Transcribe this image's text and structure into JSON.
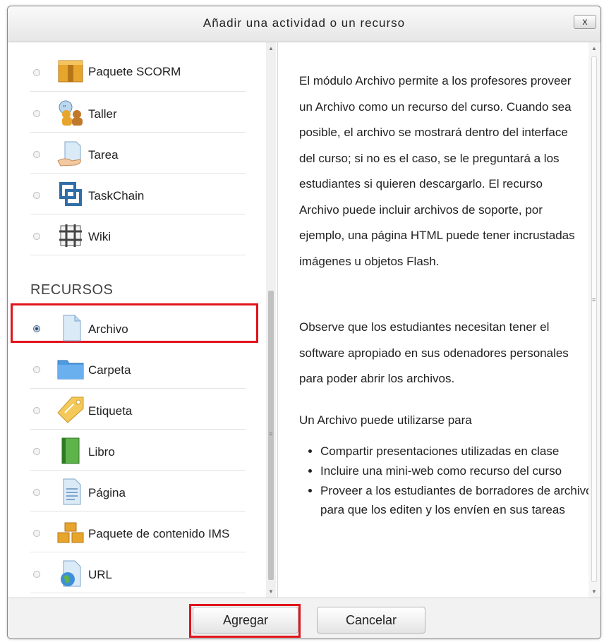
{
  "dialog": {
    "title": "Añadir una actividad o un recurso",
    "close_label": "x"
  },
  "activities": [
    {
      "label": "Paquete SCORM",
      "icon": "scorm-package-icon",
      "selected": false
    },
    {
      "label": "Taller",
      "icon": "workshop-icon",
      "selected": false
    },
    {
      "label": "Tarea",
      "icon": "assignment-icon",
      "selected": false
    },
    {
      "label": "TaskChain",
      "icon": "taskchain-icon",
      "selected": false
    },
    {
      "label": "Wiki",
      "icon": "wiki-icon",
      "selected": false
    }
  ],
  "resources_title": "RECURSOS",
  "resources": [
    {
      "label": "Archivo",
      "icon": "file-icon",
      "selected": true
    },
    {
      "label": "Carpeta",
      "icon": "folder-icon",
      "selected": false
    },
    {
      "label": "Etiqueta",
      "icon": "label-tag-icon",
      "selected": false
    },
    {
      "label": "Libro",
      "icon": "book-icon",
      "selected": false
    },
    {
      "label": "Página",
      "icon": "page-icon",
      "selected": false
    },
    {
      "label": "Paquete de contenido IMS",
      "icon": "ims-package-icon",
      "selected": false
    },
    {
      "label": "URL",
      "icon": "url-globe-icon",
      "selected": false
    }
  ],
  "description": {
    "para1": "El módulo Archivo permite a los profesores proveer un Archivo como un recurso del curso. Cuando sea posible, el archivo se mostrará dentro del interface del curso; si no es el caso, se le preguntará a los estudiantes si quieren descargarlo. El recurso Archivo puede incluir archivos de soporte, por ejemplo, una página HTML puede tener incrustadas imágenes u objetos Flash.",
    "para2": "Observe que los estudiantes necesitan tener el software apropiado en sus odenadores personales para poder abrir los archivos.",
    "para3": "Un Archivo puede utilizarse para",
    "uses": [
      "Compartir presentaciones utilizadas en clase",
      "Incluire una mini-web como recurso del curso",
      "Proveer a los estudiantes de borradores de archivos para que los editen y los envíen en sus tareas"
    ]
  },
  "footer": {
    "add_label": "Agregar",
    "cancel_label": "Cancelar"
  },
  "colors": {
    "highlight": "#e0141b",
    "header_bg": "#e6e6e6"
  }
}
